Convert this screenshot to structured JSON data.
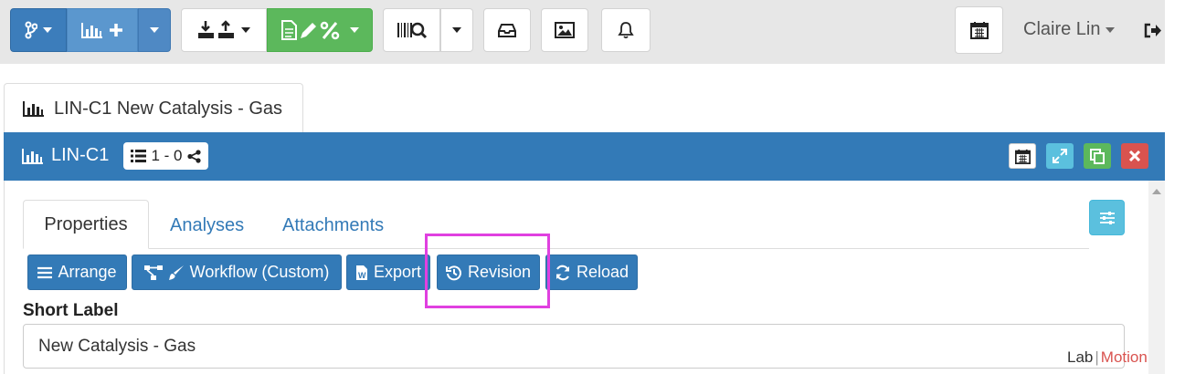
{
  "navbar": {
    "icons": {
      "branch": "code-branch-icon",
      "new_element": "chart-bar-plus-icon",
      "import_export": "import-export-icon",
      "report_tools": "file-pen-percent-icon",
      "barcode_search": "barcode-search-icon",
      "inbox": "inbox-icon",
      "image": "image-icon",
      "bell": "bell-icon",
      "calendar": "calendar-icon",
      "logout": "sign-out-icon"
    },
    "user_name": "Claire Lin"
  },
  "element_tab": {
    "icon": "chart-bar-icon",
    "title": "LIN-C1 New Catalysis - Gas"
  },
  "panel": {
    "icon": "chart-bar-icon",
    "title": "LIN-C1",
    "badge": {
      "icon": "list-icon",
      "text": "1 - 0",
      "share_icon": "share-icon"
    },
    "header_buttons": [
      "calendar-icon",
      "expand-icon",
      "copy-icon",
      "close-icon"
    ],
    "colors": {
      "header": "#337ab7",
      "expand": "#5bc0de",
      "copy": "#5cb85c",
      "close": "#d9534f"
    }
  },
  "tabs": [
    {
      "label": "Properties",
      "active": true
    },
    {
      "label": "Analyses",
      "active": false
    },
    {
      "label": "Attachments",
      "active": false
    }
  ],
  "actions": {
    "arrange": "Arrange",
    "workflow": "Workflow (Custom)",
    "export": "Export",
    "revision": "Revision",
    "reload": "Reload"
  },
  "fields": {
    "short_label": {
      "label": "Short Label",
      "value": "New Catalysis - Gas"
    }
  },
  "logo": {
    "lab": "Lab",
    "motion": "Motion"
  },
  "colors": {
    "primary": "#337ab7",
    "success": "#5cb85c",
    "info": "#5bc0de",
    "danger": "#d9534f",
    "highlight": "#e040e0"
  }
}
